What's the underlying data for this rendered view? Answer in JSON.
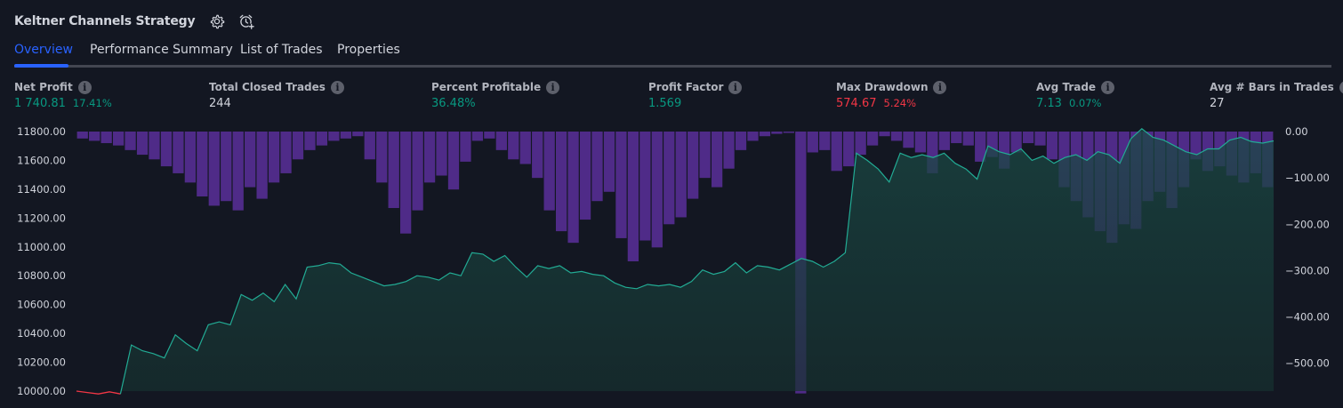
{
  "header": {
    "title": "Keltner Channels Strategy"
  },
  "tabs": [
    {
      "label": "Overview",
      "active": true
    },
    {
      "label": "Performance Summary",
      "active": false
    },
    {
      "label": "List of Trades",
      "active": false
    },
    {
      "label": "Properties",
      "active": false
    }
  ],
  "metrics": {
    "net_profit": {
      "label": "Net Profit",
      "value": "1 740.81",
      "pct": "17.41%"
    },
    "total_closed_trades": {
      "label": "Total Closed Trades",
      "value": "244"
    },
    "percent_profitable": {
      "label": "Percent Profitable",
      "value": "36.48%"
    },
    "profit_factor": {
      "label": "Profit Factor",
      "value": "1.569"
    },
    "max_drawdown": {
      "label": "Max Drawdown",
      "value": "574.67",
      "pct": "5.24%"
    },
    "avg_trade": {
      "label": "Avg Trade",
      "value": "7.13",
      "pct": "0.07%"
    },
    "avg_bars": {
      "label": "Avg # Bars in Trades",
      "value": "27"
    }
  },
  "icons": {
    "settings": "gear-icon",
    "alert": "alarm-clock-plus-icon",
    "info": "info-icon"
  },
  "colors": {
    "background": "#131722",
    "accent_blue": "#2962ff",
    "positive_green": "#089981",
    "negative_red": "#f23645",
    "equity_line": "#22ab94",
    "drawdown_bars": "#5b2f9a"
  },
  "chart_data": {
    "type": "area",
    "left_axis": {
      "ticks": [
        "11800.00",
        "11600.00",
        "11400.00",
        "11200.00",
        "11000.00",
        "10800.00",
        "10600.00",
        "10400.00",
        "10200.00",
        "10000.00"
      ],
      "range": [
        10000,
        11800
      ]
    },
    "right_axis": {
      "ticks": [
        "0.00",
        "−100.00",
        "−200.00",
        "−300.00",
        "−400.00",
        "−500.00"
      ],
      "range": [
        -560,
        0
      ]
    },
    "series": [
      {
        "kind": "equity",
        "values": [
          10000,
          9990,
          9980,
          9995,
          9980,
          10320,
          10280,
          10260,
          10230,
          10390,
          10330,
          10280,
          10460,
          10480,
          10460,
          10670,
          10630,
          10680,
          10620,
          10740,
          10640,
          10860,
          10870,
          10890,
          10880,
          10820,
          10790,
          10760,
          10730,
          10740,
          10760,
          10800,
          10790,
          10770,
          10820,
          10800,
          10960,
          10950,
          10900,
          10940,
          10860,
          10790,
          10870,
          10850,
          10870,
          10820,
          10830,
          10810,
          10800,
          10750,
          10720,
          10710,
          10740,
          10730,
          10740,
          10720,
          10760,
          10840,
          10810,
          10830,
          10890,
          10820,
          10870,
          10860,
          10840,
          10880,
          10920,
          10900,
          10860,
          10900,
          10960,
          11650,
          11600,
          11540,
          11450,
          11650,
          11620,
          11640,
          11620,
          11650,
          11580,
          11540,
          11470,
          11700,
          11660,
          11640,
          11680,
          11600,
          11630,
          11580,
          11620,
          11640,
          11600,
          11660,
          11640,
          11580,
          11750,
          11820,
          11760,
          11740,
          11700,
          11660,
          11640,
          11680,
          11680,
          11740,
          11760,
          11730,
          11720,
          11735
        ]
      },
      {
        "kind": "drawdown",
        "values": [
          -15,
          -20,
          -25,
          -30,
          -40,
          -50,
          -60,
          -75,
          -90,
          -110,
          -140,
          -160,
          -150,
          -170,
          -120,
          -145,
          -110,
          -90,
          -60,
          -40,
          -30,
          -20,
          -15,
          -10,
          -60,
          -110,
          -165,
          -220,
          -170,
          -110,
          -95,
          -125,
          -65,
          -20,
          -15,
          -40,
          -60,
          -70,
          -100,
          -170,
          -215,
          -240,
          -190,
          -150,
          -130,
          -230,
          -280,
          -235,
          -250,
          -200,
          -185,
          -145,
          -100,
          -120,
          -80,
          -40,
          -20,
          -10,
          -5,
          0,
          -565,
          -45,
          -40,
          -85,
          -75,
          -50,
          -30,
          -10,
          -20,
          -35,
          -45,
          -90,
          -40,
          -25,
          -30,
          -65,
          -55,
          -80,
          -45,
          -25,
          -30,
          -60,
          -120,
          -150,
          -185,
          -215,
          -240,
          -200,
          -210,
          -150,
          -130,
          -165,
          -120,
          -60,
          -85,
          -75,
          -95,
          -110,
          -90,
          -120
        ]
      }
    ]
  }
}
